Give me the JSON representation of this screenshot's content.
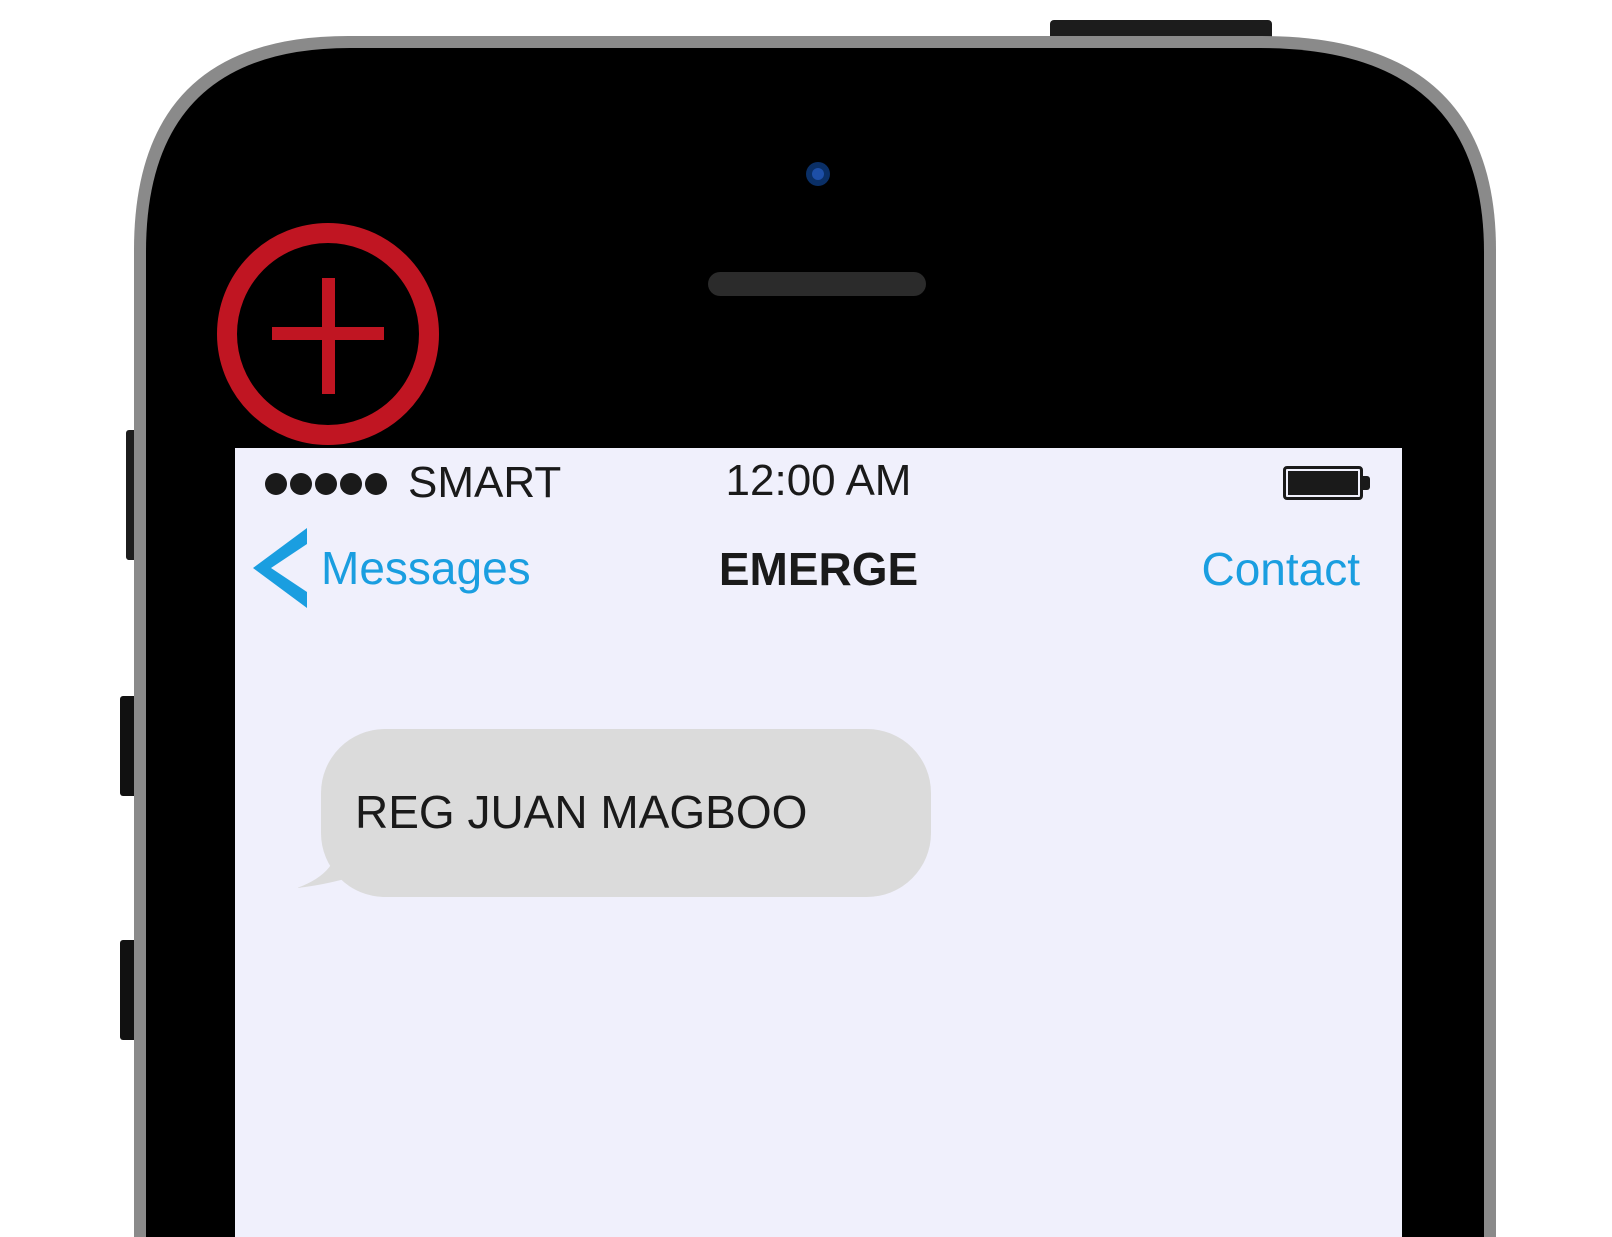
{
  "status_bar": {
    "signal_bars": 5,
    "carrier": "SMART",
    "time": "12:00 AM",
    "battery_level": 1.0
  },
  "nav_bar": {
    "back_label": "Messages",
    "title": "EMERGE",
    "action_label": "Contact"
  },
  "messages": [
    {
      "text": "REG JUAN MAGBOO",
      "direction": "incoming"
    }
  ],
  "overlay_icon": "add-circle-icon",
  "colors": {
    "accent": "#1a9ee0",
    "plus_badge": "#c01522",
    "bubble": "#dbdbdb",
    "screen_bg": "#f0f0fc",
    "phone_body": "#000000"
  }
}
